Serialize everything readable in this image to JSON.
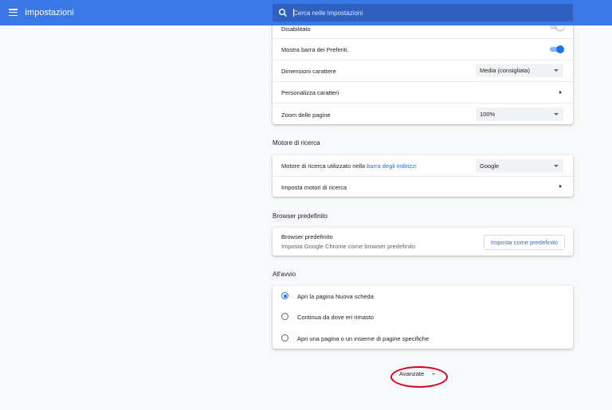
{
  "header": {
    "title": "Impostazioni",
    "search_placeholder": "Cerca nelle impostazioni"
  },
  "appearance": {
    "partial_label": "Disabilitato",
    "bookmarks_label": "Mostra barra dei Preferiti.",
    "font_size_label": "Dimensioni carattere",
    "font_size_value": "Media (consigliata)",
    "custom_fonts_label": "Personalizza caratteri",
    "zoom_label": "Zoom delle pagine",
    "zoom_value": "100%"
  },
  "search_engine": {
    "section_title": "Motore di ricerca",
    "engine_label_prefix": "Motore di ricerca utilizzato nella ",
    "engine_label_link": "barra degli indirizzi",
    "engine_value": "Google",
    "manage_label": "Imposta motori di ricerca"
  },
  "default_browser": {
    "section_title": "Browser predefinito",
    "label": "Browser predefinito",
    "sublabel": "Imposta Google Chrome come browser predefinito",
    "button_label": "Imposta come predefinito"
  },
  "startup": {
    "section_title": "All'avvio",
    "options": [
      {
        "label": "Apri la pagina Nuova scheda",
        "selected": true
      },
      {
        "label": "Continua da dove eri rimasto",
        "selected": false
      },
      {
        "label": "Apri una pagina o un insieme di pagine specifiche",
        "selected": false
      }
    ]
  },
  "advanced_label": "Avanzate",
  "colors": {
    "accent": "#1a73e8",
    "header": "#3b78e7",
    "highlight_ellipse": "#d8001a"
  }
}
